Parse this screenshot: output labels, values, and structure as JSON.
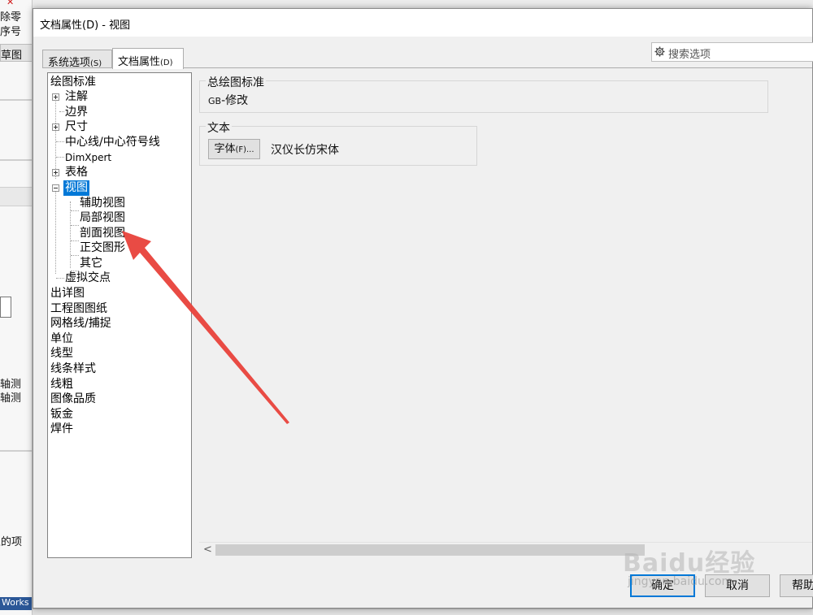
{
  "background": {
    "left_panel_texts": [
      "除零",
      "序号",
      "草图",
      "轴测",
      "轴测",
      "性的项"
    ],
    "status_text": "Works D"
  },
  "dialog": {
    "title": "文档属性(D) - 视图",
    "tabs": [
      {
        "label": "系统选项",
        "accel": "(S)"
      },
      {
        "label": "文档属性",
        "accel": "(D)"
      }
    ],
    "search_placeholder": "搜索选项"
  },
  "tree": {
    "items": [
      {
        "label": "绘图标准"
      },
      {
        "label": "注解"
      },
      {
        "label": "边界"
      },
      {
        "label": "尺寸"
      },
      {
        "label": "中心线/中心符号线"
      },
      {
        "label": "DimXpert"
      },
      {
        "label": "表格"
      },
      {
        "label": "视图",
        "selected": true
      },
      {
        "label": "辅助视图"
      },
      {
        "label": "局部视图"
      },
      {
        "label": "剖面视图"
      },
      {
        "label": "正交图形"
      },
      {
        "label": "其它"
      },
      {
        "label": "虚拟交点"
      },
      {
        "label": "出详图"
      },
      {
        "label": "工程图图纸"
      },
      {
        "label": "网格线/捕捉"
      },
      {
        "label": "单位"
      },
      {
        "label": "线型"
      },
      {
        "label": "线条样式"
      },
      {
        "label": "线粗"
      },
      {
        "label": "图像品质"
      },
      {
        "label": "钣金"
      },
      {
        "label": "焊件"
      }
    ]
  },
  "panel": {
    "overall_standard_label": "总绘图标准",
    "overall_standard_prefix": "GB",
    "overall_standard_value": "-修改",
    "text_group_label": "文本",
    "font_button_label": "字体",
    "font_button_accel": "(F)...",
    "font_name": "汉仪长仿宋体"
  },
  "buttons": {
    "ok": "确定",
    "cancel": "取消",
    "help": "帮助"
  },
  "watermark": {
    "text": "Baidu经验",
    "sub": "jingyan.baidu.com"
  },
  "colors": {
    "selection": "#0078d7",
    "arrow": "#e8413a"
  }
}
